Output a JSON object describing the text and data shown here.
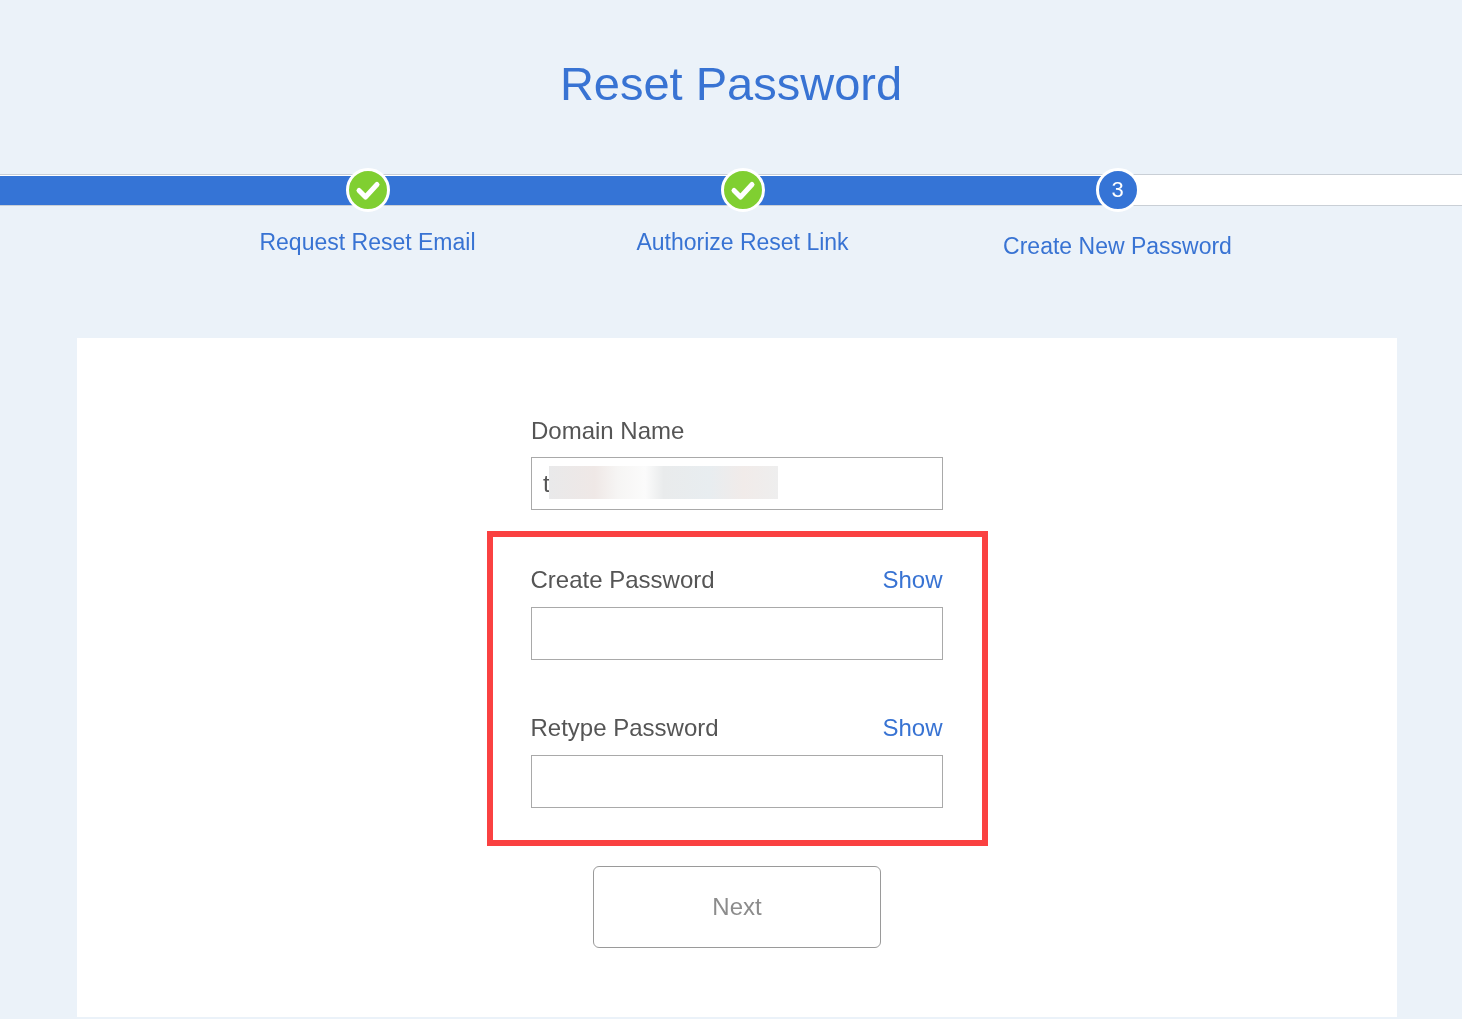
{
  "title": "Reset Password",
  "progress": {
    "level": 0.765,
    "steps": [
      {
        "label": "Request Reset Email",
        "kind": "done"
      },
      {
        "label": "Authorize Reset Link",
        "kind": "done"
      },
      {
        "label": "Create New Password",
        "kind": "current",
        "number": "3"
      }
    ]
  },
  "form": {
    "domain": {
      "label": "Domain Name",
      "value": "t",
      "redacted": true
    },
    "password_group": {
      "highlighted": true,
      "fields": [
        {
          "label": "Create Password",
          "toggle": "Show"
        },
        {
          "label": "Retype Password",
          "toggle": "Show"
        }
      ]
    },
    "next_button": {
      "label": "Next",
      "disabled": true
    }
  }
}
